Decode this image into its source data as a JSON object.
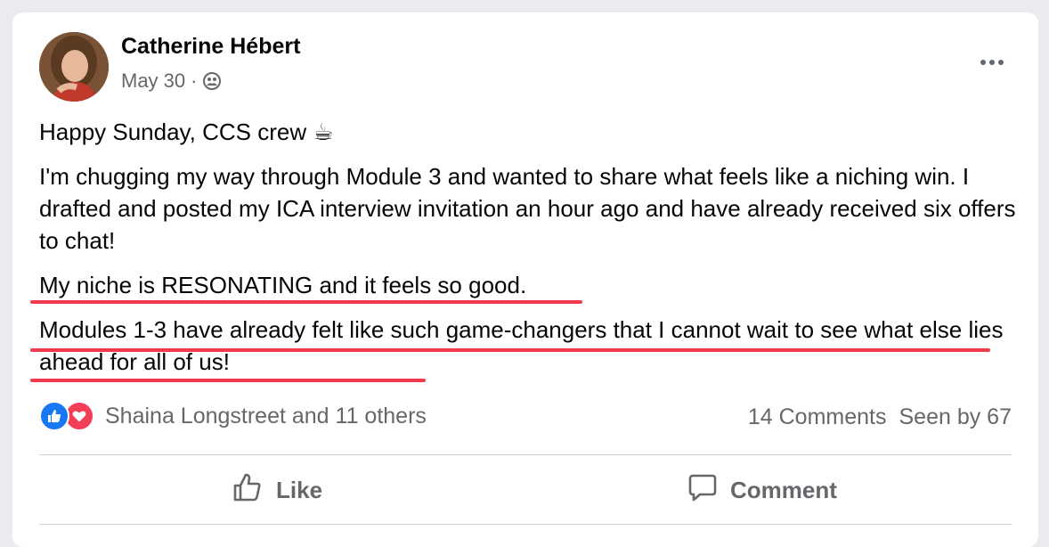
{
  "post": {
    "author": "Catherine Hébert",
    "date": "May 30",
    "separator": "·",
    "audience_icon": "group-audience-icon",
    "paragraphs": [
      "Happy Sunday, CCS crew ☕",
      "I'm chugging my way through Module 3 and wanted to share what feels like a niching win.  I drafted and posted my ICA interview invitation an hour ago and have already received six offers to chat!",
      "My niche is RESONATING and it feels so good.",
      "Modules 1-3 have already felt like such game-changers that I cannot wait to see what else lies ahead for all of us!"
    ]
  },
  "reactions": {
    "icons": [
      "like-reaction-icon",
      "love-reaction-icon"
    ],
    "text": "Shaina Longstreet and 11 others"
  },
  "stats": {
    "comments": "14 Comments",
    "seen": "Seen by 67"
  },
  "actions": {
    "like_label": "Like",
    "comment_label": "Comment"
  },
  "colors": {
    "highlight_underline": "#ee3a4a",
    "like_blue": "#1877f2",
    "love_red": "#f33e58",
    "secondary_text": "#65676b"
  }
}
